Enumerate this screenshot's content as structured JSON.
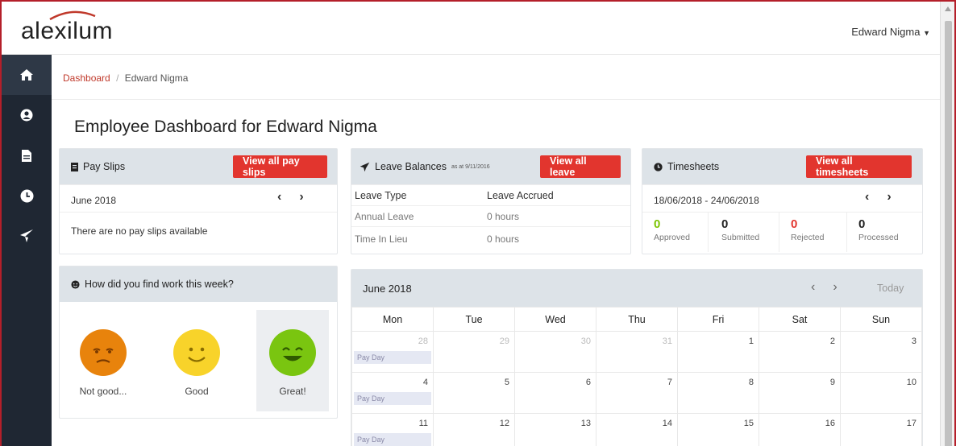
{
  "app": {
    "logo_text": "alexilum",
    "user_name": "Edward Nigma"
  },
  "sidebar": {
    "items": [
      {
        "name": "home",
        "icon": "home-icon"
      },
      {
        "name": "profile",
        "icon": "user-icon"
      },
      {
        "name": "documents",
        "icon": "file-icon"
      },
      {
        "name": "timesheets",
        "icon": "clock-icon"
      },
      {
        "name": "leave",
        "icon": "plane-icon"
      }
    ]
  },
  "breadcrumb": {
    "link": "Dashboard",
    "separator": "/",
    "current": "Edward Nigma"
  },
  "page_title": "Employee Dashboard for Edward Nigma",
  "payslips": {
    "title": "Pay Slips",
    "button": "View all pay slips",
    "month": "June 2018",
    "empty": "There are no pay slips available"
  },
  "leave": {
    "title": "Leave Balances",
    "as_at": "as at 9/11/2016",
    "button": "View all leave",
    "col_type": "Leave Type",
    "col_accrued": "Leave Accrued",
    "rows": [
      {
        "type": "Annual Leave",
        "accrued": "0 hours"
      },
      {
        "type": "Time In Lieu",
        "accrued": "0 hours"
      }
    ]
  },
  "timesheets": {
    "title": "Timesheets",
    "button": "View all timesheets",
    "range": "18/06/2018 - 24/06/2018",
    "stats": [
      {
        "value": "0",
        "label": "Approved",
        "color": "#7cc400"
      },
      {
        "value": "0",
        "label": "Submitted",
        "color": "#222222"
      },
      {
        "value": "0",
        "label": "Rejected",
        "color": "#e2352e"
      },
      {
        "value": "0",
        "label": "Processed",
        "color": "#222222"
      }
    ]
  },
  "mood": {
    "title": "How did you find work this week?",
    "options": [
      {
        "label": "Not good...",
        "color": "#e8830c"
      },
      {
        "label": "Good",
        "color": "#f8d32a"
      },
      {
        "label": "Great!",
        "color": "#7ac510",
        "selected": true
      }
    ]
  },
  "calendar": {
    "month": "June 2018",
    "today": "Today",
    "days": [
      "Mon",
      "Tue",
      "Wed",
      "Thu",
      "Fri",
      "Sat",
      "Sun"
    ],
    "weeks": [
      [
        {
          "d": "28",
          "other": true,
          "event": "Pay Day"
        },
        {
          "d": "29",
          "other": true
        },
        {
          "d": "30",
          "other": true
        },
        {
          "d": "31",
          "other": true
        },
        {
          "d": "1"
        },
        {
          "d": "2"
        },
        {
          "d": "3"
        }
      ],
      [
        {
          "d": "4",
          "event": "Pay Day"
        },
        {
          "d": "5"
        },
        {
          "d": "6"
        },
        {
          "d": "7"
        },
        {
          "d": "8"
        },
        {
          "d": "9"
        },
        {
          "d": "10"
        }
      ],
      [
        {
          "d": "11",
          "event": "Pay Day"
        },
        {
          "d": "12"
        },
        {
          "d": "13"
        },
        {
          "d": "14"
        },
        {
          "d": "15"
        },
        {
          "d": "16"
        },
        {
          "d": "17"
        }
      ]
    ]
  },
  "colors": {
    "accent": "#e2352e",
    "sidebar": "#1f2733",
    "panel_header": "#dde3e8",
    "link": "#c0392b"
  }
}
